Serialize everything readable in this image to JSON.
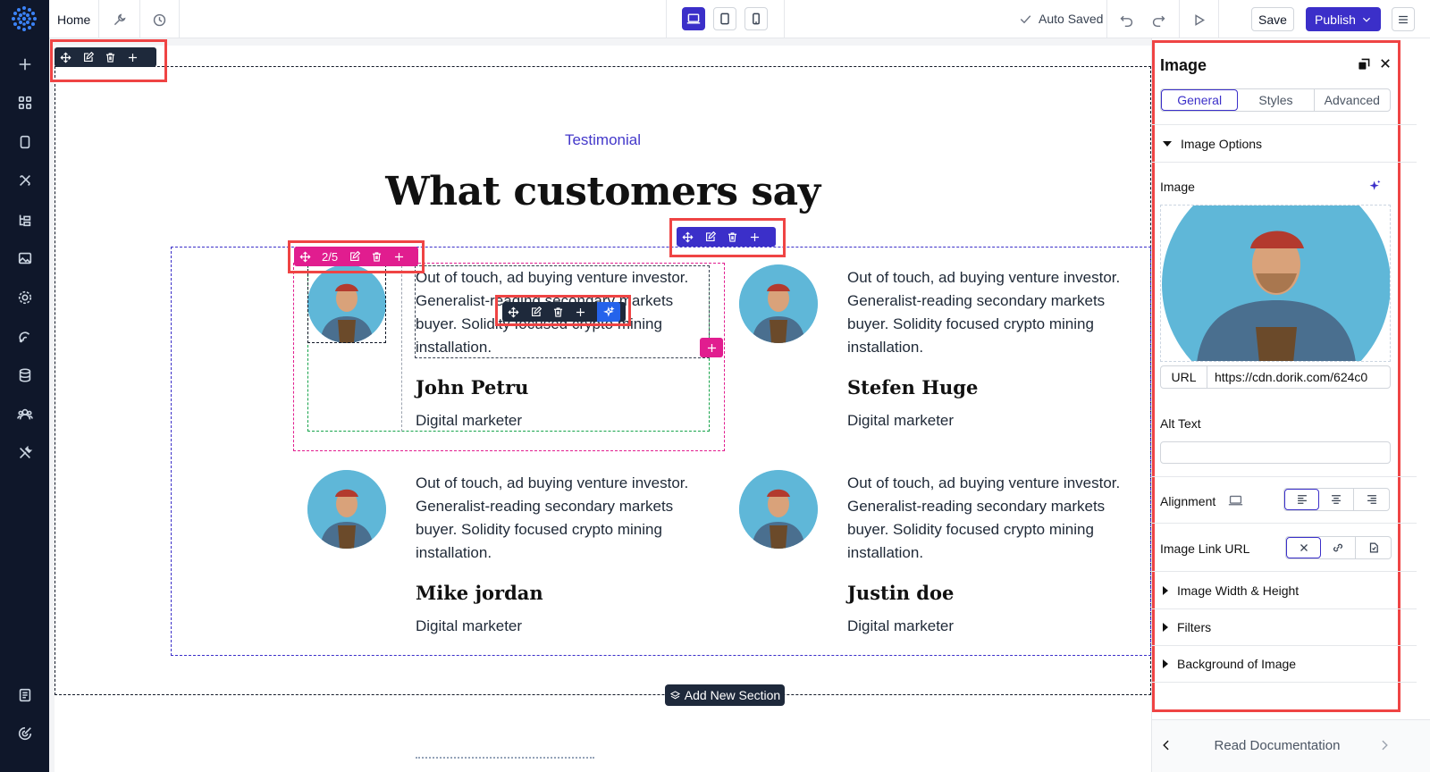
{
  "topbar": {
    "home_label": "Home",
    "auto_saved": "Auto Saved",
    "save_label": "Save",
    "publish_label": "Publish"
  },
  "canvas": {
    "eyebrow": "Testimonial",
    "heading": "What customers say",
    "column_toolbar_counter": "2/5",
    "add_section_label": "Add New Section",
    "testimonials": [
      {
        "quote": "Out of touch, ad buying venture investor. Generalist-reading secondary markets buyer. Solidity focused crypto mining installation.",
        "name": "John Petru",
        "role": "Digital marketer"
      },
      {
        "quote": "Out of touch, ad buying venture investor. Generalist-reading secondary markets buyer. Solidity focused crypto mining installation.",
        "name": "Stefen Huge",
        "role": "Digital marketer"
      },
      {
        "quote": "Out of touch, ad buying venture investor. Generalist-reading secondary markets buyer. Solidity focused crypto mining installation.",
        "name": "Mike jordan",
        "role": "Digital marketer"
      },
      {
        "quote": "Out of touch, ad buying venture investor. Generalist-reading secondary markets buyer. Solidity focused crypto mining installation.",
        "name": "Justin doe",
        "role": "Digital marketer"
      }
    ]
  },
  "panel": {
    "title": "Image",
    "tabs": [
      "General",
      "Styles",
      "Advanced"
    ],
    "image_options": "Image Options",
    "image_label": "Image",
    "url_label": "URL",
    "url_value": "https://cdn.dorik.com/624c0",
    "alt_text_label": "Alt Text",
    "alt_text_value": "",
    "alignment_label": "Alignment",
    "image_link_label": "Image Link URL",
    "sections": [
      "Image Width & Height",
      "Filters",
      "Background of Image"
    ],
    "read_doc": "Read Documentation"
  },
  "colors": {
    "brand": "#3b2fc9",
    "sidebar": "#0f172a",
    "pink": "#e11d8f",
    "highlight": "#ef4444",
    "avatar_bg": "#5fb7d8"
  }
}
